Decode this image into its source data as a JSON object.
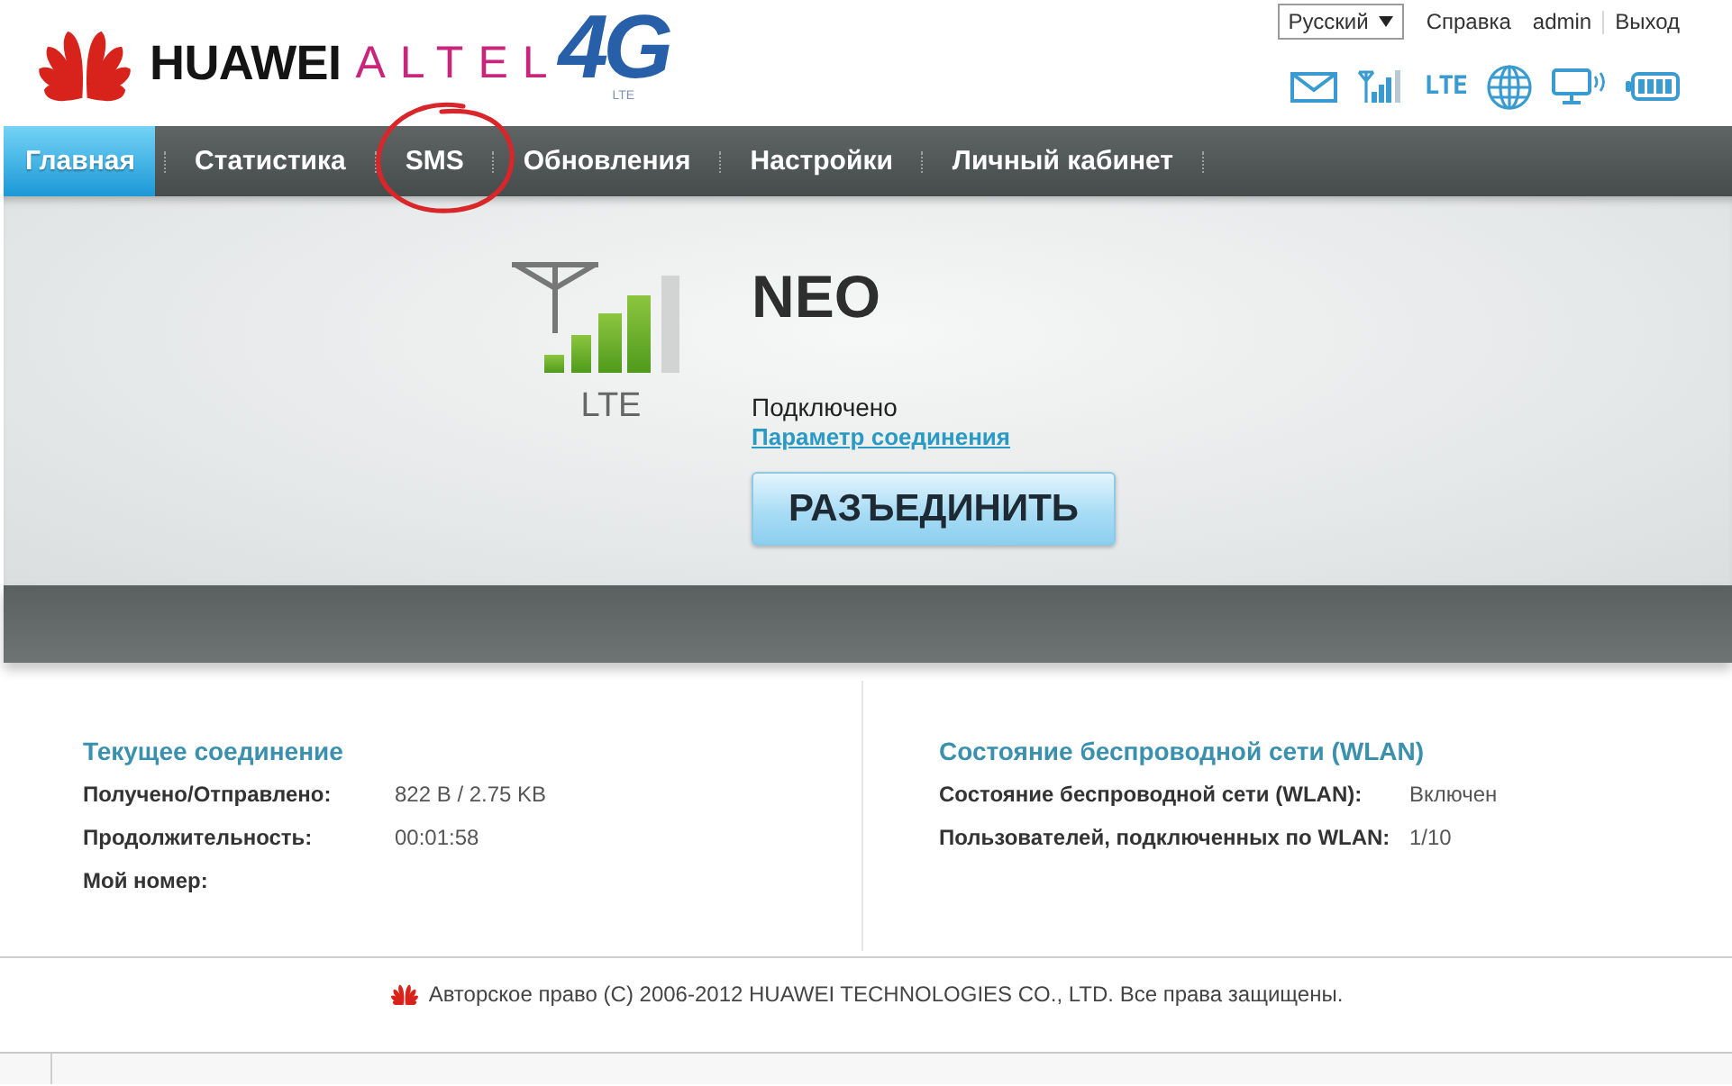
{
  "header": {
    "logo": {
      "brand": "HUAWEI",
      "operator": "ALTEL",
      "badge": "4G",
      "badge_caption": "LTE"
    },
    "language": {
      "value": "Русский"
    },
    "links": [
      {
        "label": "Справка",
        "kind": "link"
      },
      {
        "label": "admin",
        "kind": "user"
      },
      {
        "label": "Выход",
        "kind": "link"
      }
    ],
    "status": {
      "network_type": "LTE"
    }
  },
  "nav": {
    "tabs": [
      {
        "label": "Главная",
        "selected": true,
        "circled": false
      },
      {
        "label": "Статистика",
        "selected": false,
        "circled": false
      },
      {
        "label": "SMS",
        "selected": false,
        "circled": true
      },
      {
        "label": "Обновления",
        "selected": false,
        "circled": false
      },
      {
        "label": "Настройки",
        "selected": false,
        "circled": false
      },
      {
        "label": "Личный кабинет",
        "selected": false,
        "circled": false
      }
    ]
  },
  "connection": {
    "network_type": "LTE",
    "operator": "NEO",
    "status": "Подключено",
    "settings_link": "Параметр соединения",
    "button": "РАЗЪЕДИНИТЬ"
  },
  "current_connection": {
    "title": "Текущее соединение",
    "rows": [
      {
        "label": "Получено/Отправлено:",
        "value": "822 B / 2.75 KB"
      },
      {
        "label": "Продолжительность:",
        "value": "00:01:58"
      },
      {
        "label": "Мой номер:"
      }
    ]
  },
  "wlan": {
    "title": "Состояние беспроводной сети (WLAN)",
    "rows": [
      {
        "label": "Состояние беспроводной сети (WLAN):",
        "value": "Включен"
      },
      {
        "label": "Пользователей, подключенных по WLAN:",
        "value": "1/10"
      }
    ]
  },
  "footer": {
    "copyright": "Авторское право (C) 2006-2012 HUAWEI TECHNOLOGIES CO., LTD. Все права защищены."
  }
}
